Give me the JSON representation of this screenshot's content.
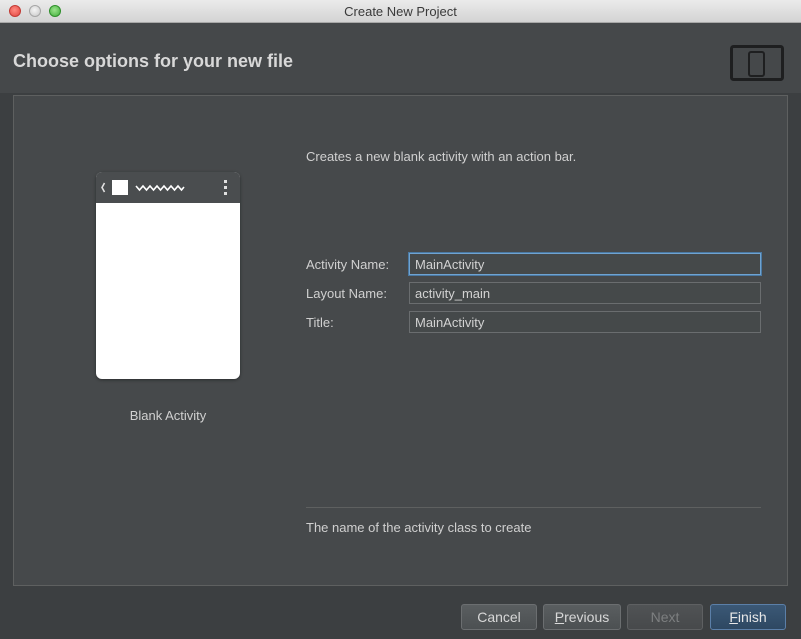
{
  "window": {
    "title": "Create New Project"
  },
  "header": {
    "title": "Choose options for your new file",
    "device_icon": "device-frame-icon"
  },
  "template": {
    "name": "Blank Activity",
    "description": "Creates a new blank activity with an action bar."
  },
  "form": {
    "activity_name": {
      "label": "Activity Name:",
      "value": "MainActivity"
    },
    "layout_name": {
      "label": "Layout Name:",
      "value": "activity_main"
    },
    "title": {
      "label": "Title:",
      "value": "MainActivity"
    }
  },
  "hint": "The name of the activity class to create",
  "buttons": {
    "cancel": "Cancel",
    "previous": {
      "mnemonic": "P",
      "rest": "revious"
    },
    "next": "Next",
    "finish": {
      "mnemonic": "F",
      "rest": "inish"
    }
  },
  "colors": {
    "background": "#3c3f41",
    "header": "#45484a",
    "focus": "#6fa3d1",
    "primary_button": "#2e4862"
  }
}
